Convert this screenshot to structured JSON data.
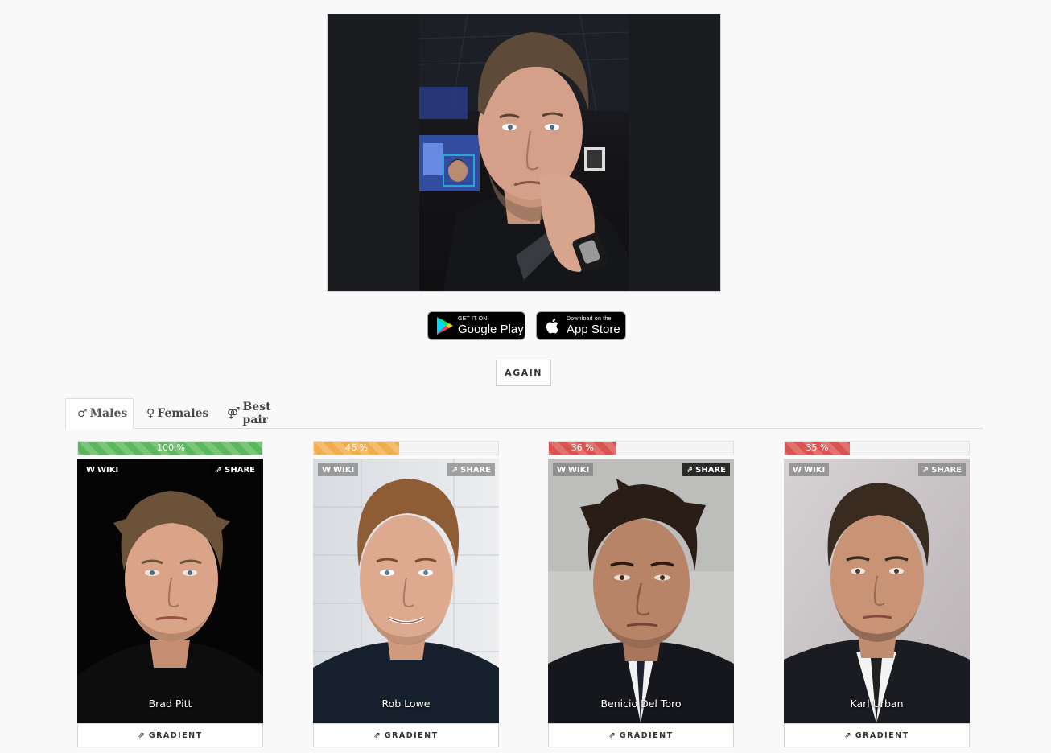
{
  "store_badges": {
    "google": {
      "small": "GET IT ON",
      "big": "Google Play"
    },
    "apple": {
      "small": "Download on the",
      "big": "App Store"
    }
  },
  "again_label": "AGAIN",
  "tabs": [
    {
      "symbol": "♂",
      "label": "Males",
      "active": true
    },
    {
      "symbol": "♀",
      "label": "Females",
      "active": false
    },
    {
      "symbol": "⚤",
      "label": "Best pair",
      "active": false
    }
  ],
  "results": [
    {
      "name": "Brad Pitt",
      "match_label": "100 %",
      "match": 100,
      "bar_color": "#5cb85c",
      "wiki": "WIKI",
      "share": "SHARE",
      "gradient": "GRADIENT"
    },
    {
      "name": "Rob Lowe",
      "match_label": "46 %",
      "match": 46,
      "bar_color": "#f0ad4e",
      "wiki": "WIKI",
      "share": "SHARE",
      "gradient": "GRADIENT"
    },
    {
      "name": "Benicio Del Toro",
      "match_label": "36 %",
      "match": 36,
      "bar_color": "#d9534f",
      "wiki": "WIKI",
      "share": "SHARE",
      "gradient": "GRADIENT"
    },
    {
      "name": "Karl Urban",
      "match_label": "35 %",
      "match": 35,
      "bar_color": "#d9534f",
      "wiki": "WIKI",
      "share": "SHARE",
      "gradient": "GRADIENT"
    }
  ]
}
